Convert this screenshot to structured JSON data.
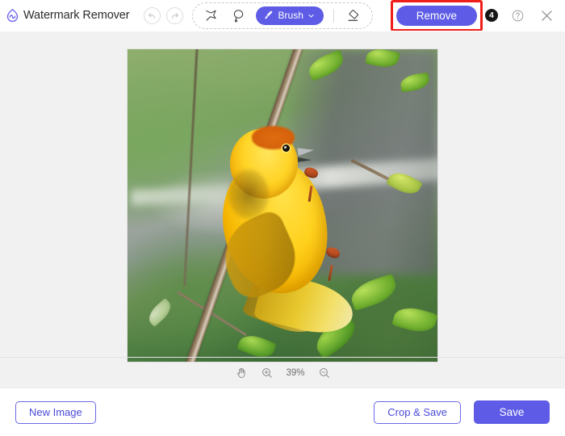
{
  "app": {
    "title": "Watermark Remover",
    "logo_icon": "water-drop-logo-icon",
    "accent_color": "#5e5ce6",
    "annotation_color": "#f01e18"
  },
  "header": {
    "undo": {
      "icon": "undo-arrow-icon",
      "label": "Undo"
    },
    "redo": {
      "icon": "redo-arrow-icon",
      "label": "Redo"
    },
    "tools": [
      {
        "name": "polygonal-lasso-tool",
        "icon": "polygonal-lasso-icon"
      },
      {
        "name": "lasso-tool",
        "icon": "lasso-icon"
      }
    ],
    "brush": {
      "label": "Brush",
      "icon": "brush-icon",
      "chevron": "chevron-down-icon"
    },
    "eraser": {
      "icon": "eraser-icon",
      "label": "Eraser"
    },
    "remove_button": {
      "label": "Remove",
      "step_badge": "4"
    },
    "help": {
      "icon": "help-circle-icon",
      "label": "Help"
    },
    "close": {
      "icon": "close-icon",
      "label": "Close"
    }
  },
  "canvas": {
    "image_alt": "Yellow weaver bird perched on a branch with green leaves"
  },
  "zoombar": {
    "pan": {
      "icon": "hand-pan-icon"
    },
    "zoom_in": {
      "icon": "zoom-in-icon"
    },
    "zoom_out": {
      "icon": "zoom-out-icon"
    },
    "zoom_level": "39%"
  },
  "footer": {
    "new_image": "New Image",
    "crop_and_save": "Crop & Save",
    "save": "Save"
  }
}
